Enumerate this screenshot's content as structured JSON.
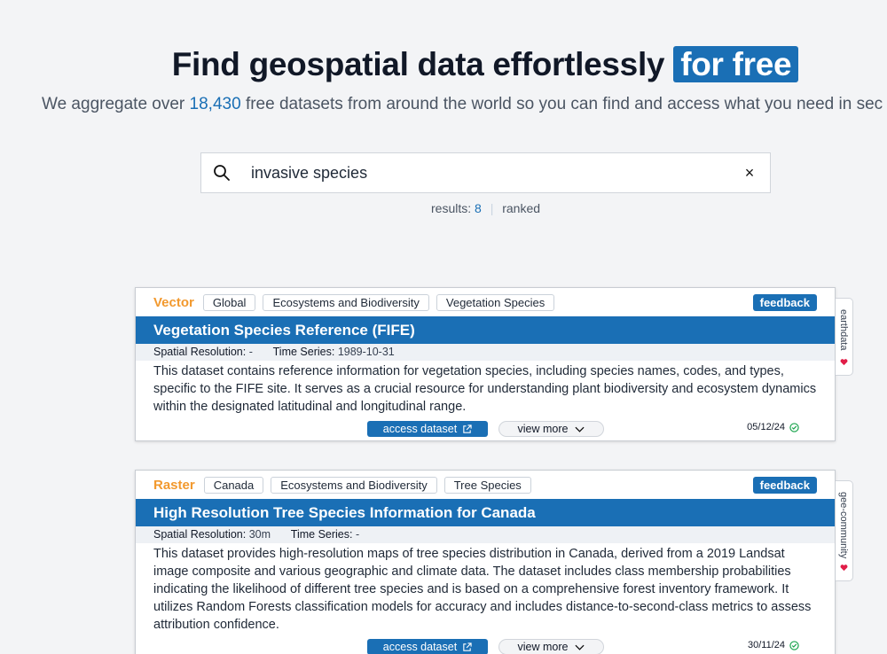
{
  "hero": {
    "title_main": "Find geospatial data effortlessly",
    "title_highlight": "for free",
    "subtitle_pre": "We aggregate over",
    "dataset_count": "18,430",
    "subtitle_post": "free datasets from around the world so you can find and access what you need in sec"
  },
  "search": {
    "query": "invasive species",
    "clear_label": "×"
  },
  "results": {
    "label": "results:",
    "count": "8",
    "separator": "|",
    "sort": "ranked"
  },
  "cards": [
    {
      "type": "Vector",
      "tags": [
        "Global",
        "Ecosystems and Biodiversity",
        "Vegetation Species"
      ],
      "feedback_label": "feedback",
      "title": "Vegetation Species Reference (FIFE)",
      "spatial_label": "Spatial Resolution:",
      "spatial_value": "-",
      "time_label": "Time Series:",
      "time_value": "1989-10-31",
      "description": "This dataset contains reference information for vegetation species, including species names, codes, and types, specific to the FIFE site. It serves as a crucial resource for understanding plant biodiversity and ecosystem dynamics within the designated latitudinal and longitudinal range.",
      "access_label": "access dataset",
      "view_more_label": "view more",
      "date": "05/12/24",
      "source": "earthdata"
    },
    {
      "type": "Raster",
      "tags": [
        "Canada",
        "Ecosystems and Biodiversity",
        "Tree Species"
      ],
      "feedback_label": "feedback",
      "title": "High Resolution Tree Species Information for Canada",
      "spatial_label": "Spatial Resolution:",
      "spatial_value": "30m",
      "time_label": "Time Series:",
      "time_value": "-",
      "description": "This dataset provides high-resolution maps of tree species distribution in Canada, derived from a 2019 Landsat image composite and various geographic and climate data. The dataset includes class membership probabilities indicating the likelihood of different tree species and is based on a comprehensive forest inventory framework. It utilizes Random Forests classification models for accuracy and includes distance-to-second-class metrics to assess attribution confidence.",
      "access_label": "access dataset",
      "view_more_label": "view more",
      "date": "30/11/24",
      "source": "gee-community"
    }
  ],
  "colors": {
    "accent": "#1a6fb5",
    "type": "#f2992e",
    "verified": "#16a34a",
    "heart": "#e11d48"
  },
  "icons": {
    "search": "search-icon",
    "external": "external-link-icon",
    "chevron": "chevron-down-icon",
    "check": "check-circle-icon",
    "heart": "heart-icon"
  }
}
